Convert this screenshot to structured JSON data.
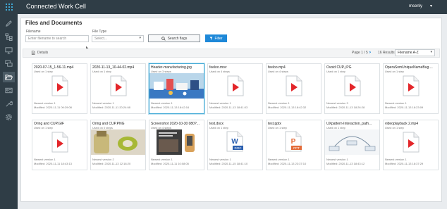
{
  "app": {
    "title": "Connected Work Cell",
    "user": "msenly"
  },
  "sidebar": {
    "items": [
      {
        "icon": "pencil-icon"
      },
      {
        "icon": "hierarchy-icon"
      },
      {
        "icon": "monitor-icon"
      },
      {
        "icon": "stacked-screens-icon"
      },
      {
        "icon": "folder-open-icon"
      },
      {
        "icon": "id-card-icon"
      },
      {
        "icon": "wrench-icon"
      },
      {
        "icon": "gear-icon"
      }
    ]
  },
  "page": {
    "title": "Files and Documents"
  },
  "filters": {
    "filename_label": "Filename",
    "filename_placeholder": "Enter filename to search",
    "filetype_label": "File Type",
    "filetype_value": "Select...",
    "search_label": "Search flags",
    "filter_label": "Filter"
  },
  "toolbar": {
    "details_label": "Details",
    "page_text": "Page 1 / 5",
    "results_text": "16 Results",
    "sort_value": "Filename A-Z"
  },
  "colors": {
    "accent": "#1e88d8",
    "video_red": "#e3262a",
    "word_blue": "#2b5faf",
    "ppt_orange": "#e36c3a",
    "sidebar": "#2f3d46"
  },
  "files": [
    {
      "name": "2020-07-15_1-56-11.mp4",
      "used": "Used on 1 step",
      "version": "Newest version 1",
      "modified": "Modified: 2020-11-11 09:29:08",
      "type": "video"
    },
    {
      "name": "2020-11-13_10-44-02.mp4",
      "used": "Used on 1 step",
      "version": "Newest version 1",
      "modified": "Modified: 2020-11-11 20:24:08",
      "type": "video"
    },
    {
      "name": "Header-manufacturing.jpg",
      "used": "Used on 3 steps",
      "version": "Newest version 1",
      "modified": "Modified: 2020-11-13 18:42:16",
      "type": "image-factory"
    },
    {
      "name": "feeloo.mov",
      "used": "Used on 4 steps",
      "version": "Newest version 1",
      "modified": "Modified: 2020-11-13 18:41:03",
      "type": "video"
    },
    {
      "name": "feeloo.mp4",
      "used": "Used on 4 steps",
      "version": "Newest version 1",
      "modified": "Modified: 2020-11-13 18:42:32",
      "type": "video"
    },
    {
      "name": "Ovoid CUP.j PG",
      "used": "Used on 1 step",
      "version": "Newest version 3",
      "modified": "Modified: 2020-11-13 18:26:28",
      "type": "video"
    },
    {
      "name": "OperaSomUniqueNameBug....",
      "used": "Used on 1 step",
      "version": "Newest version 1",
      "modified": "Modified: 2020-11-13 18:23:09",
      "type": "video"
    },
    {
      "name": "Oring and CUP.GIF",
      "used": "Used on 1 step",
      "version": "Newest version 1",
      "modified": "Modified: 2020-11-11 18:43:13",
      "type": "video"
    },
    {
      "name": "Oring and CUP.PNG",
      "used": "Used on 0 steps",
      "version": "Newest version 2",
      "modified": "Modified: 2020-11-13 12:18:20",
      "type": "image-cup"
    },
    {
      "name": "Screenshot 2020-10-30 080?...",
      "used": "Used on 4 steps",
      "version": "Newest version 1",
      "modified": "Modified: 2020-11-11 10:08:05",
      "type": "image-screenshot"
    },
    {
      "name": "test.docx",
      "used": "Used on 1 step",
      "version": "Newest version 1",
      "modified": "Modified: 2020-11-15 18:41:10",
      "type": "docx",
      "badge": "DOC"
    },
    {
      "name": "test.pptx",
      "used": "Used on 1 step",
      "version": "Newest version 1",
      "modified": "Modified: 2020-11-13 23:37:10",
      "type": "pptx",
      "badge": "PPT"
    },
    {
      "name": "UXpattern-Interaction_path...",
      "used": "Used on 1 step",
      "version": "Newest version 1",
      "modified": "Modified: 2020-11-13 18:43:12",
      "type": "image-diagram"
    },
    {
      "name": "videoplayback 2.mp4",
      "used": "Used on 1 step",
      "version": "Newest version 1",
      "modified": "Modified: 2020-11-13 18:37:29",
      "type": "video"
    }
  ]
}
